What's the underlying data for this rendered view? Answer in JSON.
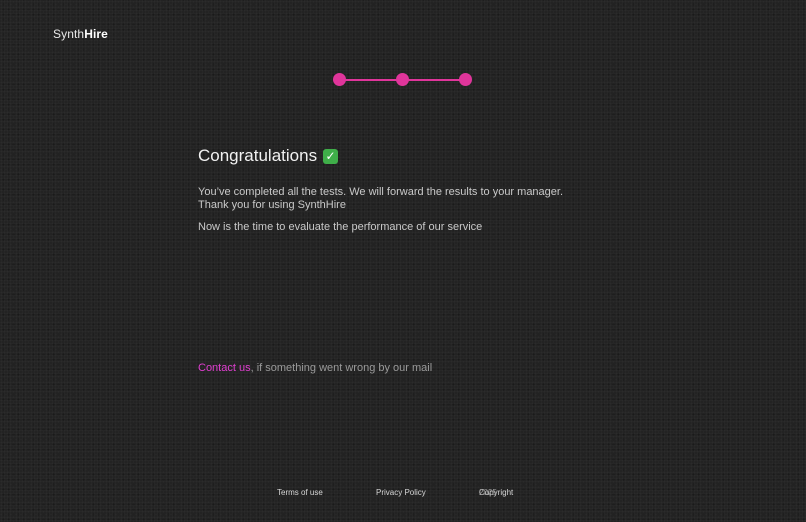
{
  "brand": {
    "prefix": "Synth",
    "suffix": "Hire"
  },
  "stepper": {
    "steps": 3,
    "completed": 3,
    "accent_color": "#e0359b"
  },
  "main": {
    "title": "Congratulations",
    "title_icon": "check-mark-icon",
    "message_line1": "You’ve completed all the tests. We will forward the results to your manager.",
    "message_line2": "Thank you for using SynthHire",
    "evaluate_text": "Now is the time to evaluate the performance of our service"
  },
  "contact": {
    "link_label": "Contact us",
    "rest_text": ", if something went wrong by our mail",
    "link_color": "#e03fd0"
  },
  "footer": {
    "terms_label": "Terms of use",
    "privacy_label": "Privacy Policy",
    "copyright_label": "Copyright",
    "copyright_year": "2025"
  }
}
